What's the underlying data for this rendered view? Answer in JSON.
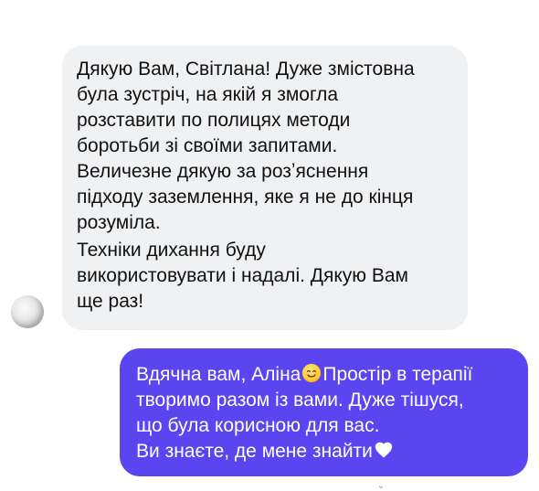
{
  "conversation": {
    "incoming": {
      "sender_avatar": "user-avatar",
      "paragraphs": [
        "Дякую Вам, Світлана! Дуже змістовна\nбула зустріч, на якій я змогла\nрозставити по полицях методи\nборотьби зі своїми запитами.\nВеличезне дякую за розʼяснення\nпідходу заземлення, яке я не до кінця\nрозуміла.",
        "Техніки дихання буду\nвикористовувати і надалі. Дякую Вам\nще раз!"
      ]
    },
    "outgoing": {
      "line1_before_emoji": "Вдячна вам, Аліна",
      "emoji_1": "smiling-face-icon",
      "line1_after_emoji": "Простір в терапії",
      "line2": "творимо разом із вами. Дуже тішуся,",
      "line3": "що була корисною для вас.",
      "line4_before_emoji": "Ви знаєте, де мене знайти",
      "emoji_2": "white-heart-icon"
    }
  },
  "colors": {
    "incoming_bubble": "#f0f1f3",
    "outgoing_bubble": "#5a45f1",
    "incoming_text": "#111111",
    "outgoing_text": "#ffffff"
  }
}
